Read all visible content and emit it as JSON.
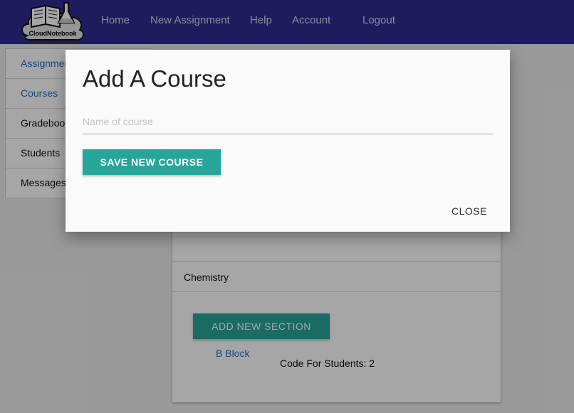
{
  "navbar": {
    "logo_text": "CloudNotebook",
    "links": [
      "Home",
      "New Assignment",
      "Help",
      "Account",
      "Logout"
    ]
  },
  "sidebar": {
    "items": [
      {
        "label": "Assignments"
      },
      {
        "label": "Courses"
      },
      {
        "label": "Gradebook"
      },
      {
        "label": "Students"
      },
      {
        "label": "Messages"
      }
    ]
  },
  "course_card": {
    "course_name": "Chemistry",
    "add_section_label": "ADD NEW SECTION",
    "sections": [
      {
        "name": "B Block",
        "code_text": "Code For Students: 2"
      }
    ]
  },
  "modal": {
    "title": "Add A Course",
    "input_placeholder": "Name of course",
    "input_value": "",
    "save_label": "SAVE NEW COURSE",
    "close_label": "CLOSE"
  },
  "colors": {
    "navbar": "#2f2b8e",
    "accent": "#26a69a",
    "link": "#1f6fcc"
  }
}
